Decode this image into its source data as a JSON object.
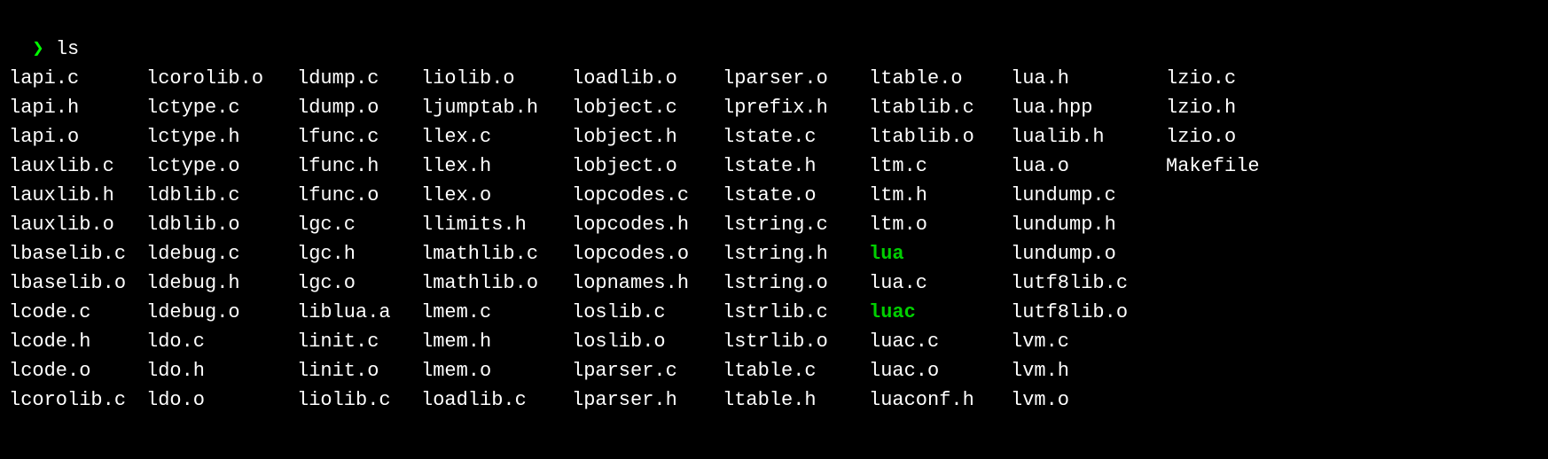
{
  "prompt": {
    "symbol": "❯",
    "command": "ls"
  },
  "listing": {
    "columns": [
      [
        "lapi.c",
        "lapi.h",
        "lapi.o",
        "lauxlib.c",
        "lauxlib.h",
        "lauxlib.o",
        "lbaselib.c",
        "lbaselib.o",
        "lcode.c",
        "lcode.h",
        "lcode.o",
        "lcorolib.c"
      ],
      [
        "lcorolib.o",
        "lctype.c",
        "lctype.h",
        "lctype.o",
        "ldblib.c",
        "ldblib.o",
        "ldebug.c",
        "ldebug.h",
        "ldebug.o",
        "ldo.c",
        "ldo.h",
        "ldo.o"
      ],
      [
        "ldump.c",
        "ldump.o",
        "lfunc.c",
        "lfunc.h",
        "lfunc.o",
        "lgc.c",
        "lgc.h",
        "lgc.o",
        "liblua.a",
        "linit.c",
        "linit.o",
        "liolib.c"
      ],
      [
        "liolib.o",
        "ljumptab.h",
        "llex.c",
        "llex.h",
        "llex.o",
        "llimits.h",
        "lmathlib.c",
        "lmathlib.o",
        "lmem.c",
        "lmem.h",
        "lmem.o",
        "loadlib.c"
      ],
      [
        "loadlib.o",
        "lobject.c",
        "lobject.h",
        "lobject.o",
        "lopcodes.c",
        "lopcodes.h",
        "lopcodes.o",
        "lopnames.h",
        "loslib.c",
        "loslib.o",
        "lparser.c",
        "lparser.h"
      ],
      [
        "lparser.o",
        "lprefix.h",
        "lstate.c",
        "lstate.h",
        "lstate.o",
        "lstring.c",
        "lstring.h",
        "lstring.o",
        "lstrlib.c",
        "lstrlib.o",
        "ltable.c",
        "ltable.h"
      ],
      [
        "ltable.o",
        "ltablib.c",
        "ltablib.o",
        "ltm.c",
        "ltm.h",
        "ltm.o",
        "lua",
        "lua.c",
        "luac",
        "luac.c",
        "luac.o",
        "luaconf.h"
      ],
      [
        "lua.h",
        "lua.hpp",
        "lualib.h",
        "lua.o",
        "lundump.c",
        "lundump.h",
        "lundump.o",
        "lutf8lib.c",
        "lutf8lib.o",
        "lvm.c",
        "lvm.h",
        "lvm.o"
      ],
      [
        "lzio.c",
        "lzio.h",
        "lzio.o",
        "Makefile",
        "",
        "",
        "",
        "",
        "",
        "",
        "",
        ""
      ]
    ],
    "executables": [
      "lua",
      "luac"
    ]
  }
}
